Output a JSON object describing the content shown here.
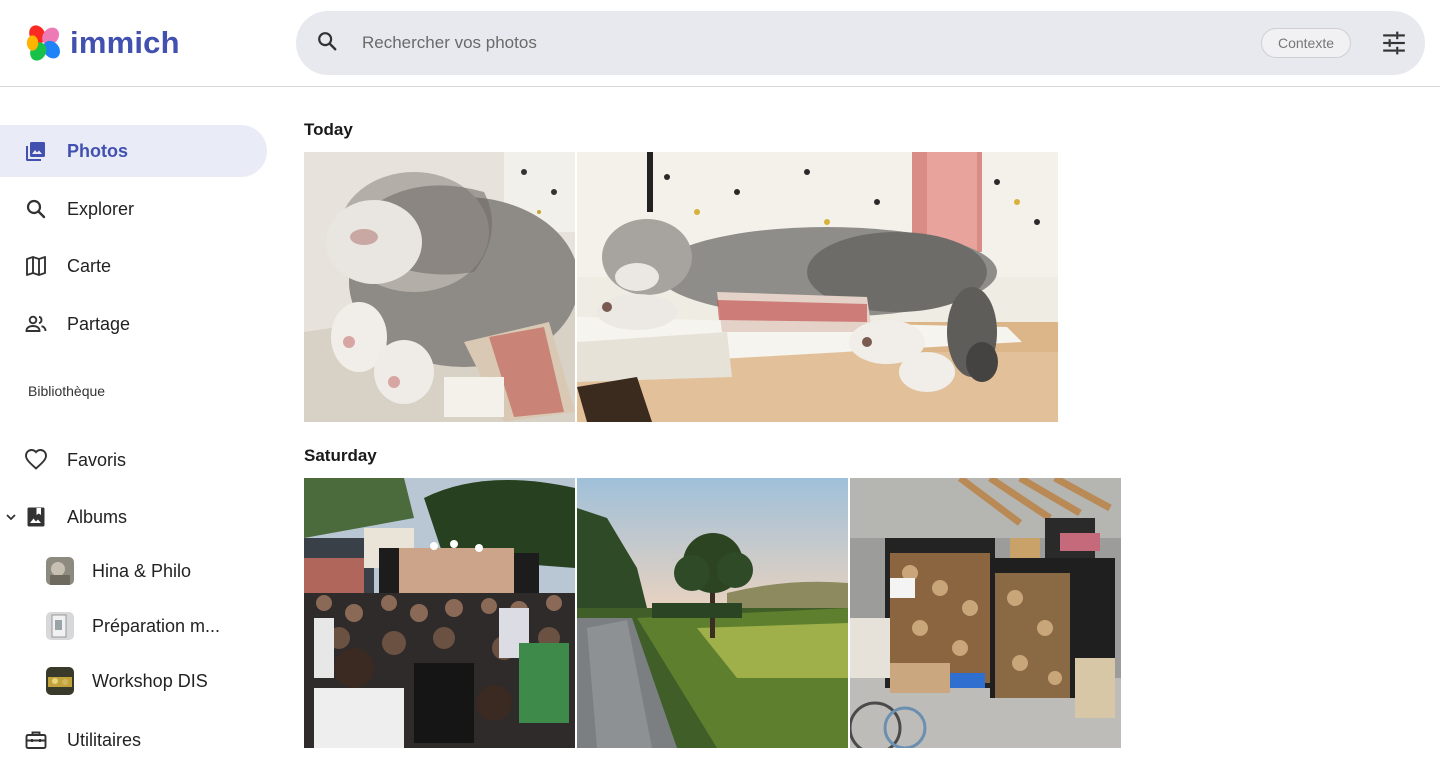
{
  "app": {
    "name": "immich"
  },
  "search": {
    "placeholder": "Rechercher vos photos",
    "context_label": "Contexte"
  },
  "sidebar": {
    "items": [
      {
        "label": "Photos",
        "icon": "photos-icon",
        "active": true
      },
      {
        "label": "Explorer",
        "icon": "search-icon"
      },
      {
        "label": "Carte",
        "icon": "map-icon"
      },
      {
        "label": "Partage",
        "icon": "people-icon"
      }
    ],
    "library_title": "Bibliothèque",
    "library_items": [
      {
        "label": "Favoris",
        "icon": "heart-icon"
      },
      {
        "label": "Albums",
        "icon": "album-icon",
        "expanded": true
      }
    ],
    "albums": [
      {
        "label": "Hina & Philo"
      },
      {
        "label": "Préparation m..."
      },
      {
        "label": "Workshop DIS"
      }
    ],
    "utilities": {
      "label": "Utilitaires",
      "icon": "toolbox-icon"
    }
  },
  "timeline": {
    "groups": [
      {
        "title": "Today",
        "photos": [
          "sleeping-kitten-closeup",
          "sleeping-kitten-on-book"
        ]
      },
      {
        "title": "Saturday",
        "photos": [
          "outdoor-concert-crowd",
          "country-road-sunset",
          "firewood-storage-shed"
        ]
      }
    ]
  },
  "colors": {
    "accent": "#4250af",
    "active_bg": "#e9ebf7",
    "search_bg": "#e8e9ee"
  }
}
